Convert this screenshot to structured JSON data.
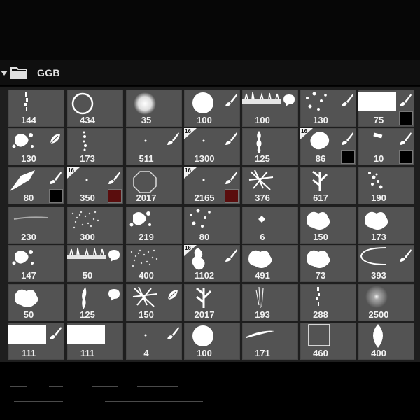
{
  "panel": {
    "group_name": "GGB"
  },
  "colors": {
    "tile": "#535353",
    "swatch_black": "#000000",
    "swatch_darkred": "#5a0d0d",
    "swatch_white": "#ffffff"
  },
  "brushes": [
    {
      "label": "144",
      "icon": "vertical-speckle-icon",
      "tool": false,
      "tag": false,
      "swatch": null
    },
    {
      "label": "434",
      "icon": "ring-icon",
      "tool": false,
      "tag": false,
      "swatch": null
    },
    {
      "label": "35",
      "icon": "soft-round-icon",
      "tool": false,
      "tag": false,
      "swatch": null
    },
    {
      "label": "100",
      "icon": "hard-round-icon",
      "tool": true,
      "tag": false,
      "swatch": null
    },
    {
      "label": "100",
      "icon": "grass-strip-icon",
      "tool": "dialog",
      "tag": false,
      "swatch": null
    },
    {
      "label": "130",
      "icon": "scatter-dots-icon",
      "tool": true,
      "tag": false,
      "swatch": null
    },
    {
      "label": "75",
      "icon": "white-rect-icon",
      "tool": true,
      "tag": false,
      "swatch": "black"
    },
    {
      "label": "130",
      "icon": "splatter-icon",
      "tool": "leaf",
      "tag": false,
      "swatch": null
    },
    {
      "label": "173",
      "icon": "dotted-line-icon",
      "tool": false,
      "tag": false,
      "swatch": null
    },
    {
      "label": "511",
      "icon": "tiny-dot-icon",
      "tool": true,
      "tag": false,
      "swatch": null
    },
    {
      "label": "1300",
      "icon": "tiny-dot-icon",
      "tool": true,
      "tag": true,
      "swatch": null
    },
    {
      "label": "125",
      "icon": "vertical-blob-icon",
      "tool": false,
      "tag": false,
      "swatch": null
    },
    {
      "label": "86",
      "icon": "blob-icon",
      "tool": true,
      "tag": true,
      "swatch": "black"
    },
    {
      "label": "10",
      "icon": "small-chip-icon",
      "tool": true,
      "tag": false,
      "swatch": "black"
    },
    {
      "label": "80",
      "icon": "wedge-icon",
      "tool": true,
      "tag": false,
      "swatch": "black"
    },
    {
      "label": "350",
      "icon": "tiny-dot-icon",
      "tool": true,
      "tag": true,
      "swatch": "darkred"
    },
    {
      "label": "2017",
      "icon": "octagon-icon",
      "tool": false,
      "tag": false,
      "swatch": null
    },
    {
      "label": "2165",
      "icon": "tiny-dot-icon",
      "tool": true,
      "tag": true,
      "swatch": "darkred"
    },
    {
      "label": "376",
      "icon": "crossed-strands-icon",
      "tool": false,
      "tag": false,
      "swatch": null
    },
    {
      "label": "617",
      "icon": "leaf-sprig-icon",
      "tool": false,
      "tag": false,
      "swatch": null
    },
    {
      "label": "190",
      "icon": "speckle-cluster-icon",
      "tool": false,
      "tag": false,
      "swatch": null
    },
    {
      "label": "230",
      "icon": "faint-line-icon",
      "tool": false,
      "tag": false,
      "swatch": null
    },
    {
      "label": "300",
      "icon": "noise-icon",
      "tool": false,
      "tag": false,
      "swatch": null
    },
    {
      "label": "219",
      "icon": "splatter-icon",
      "tool": false,
      "tag": false,
      "swatch": null
    },
    {
      "label": "80",
      "icon": "scatter-dots-icon",
      "tool": false,
      "tag": false,
      "swatch": null
    },
    {
      "label": "6",
      "icon": "diamond-icon",
      "tool": false,
      "tag": false,
      "swatch": null
    },
    {
      "label": "150",
      "icon": "cloud-blob-icon",
      "tool": false,
      "tag": false,
      "swatch": null
    },
    {
      "label": "173",
      "icon": "cloud-blob-icon",
      "tool": false,
      "tag": false,
      "swatch": null
    },
    {
      "label": "147",
      "icon": "splatter-icon",
      "tool": false,
      "tag": false,
      "swatch": null
    },
    {
      "label": "50",
      "icon": "grass-strip-icon",
      "tool": "dialog",
      "tag": false,
      "swatch": null
    },
    {
      "label": "400",
      "icon": "noise-icon",
      "tool": false,
      "tag": false,
      "swatch": null
    },
    {
      "label": "1102",
      "icon": "tree-icon",
      "tool": true,
      "tag": true,
      "swatch": null
    },
    {
      "label": "491",
      "icon": "cloud-blob-icon",
      "tool": false,
      "tag": false,
      "swatch": null
    },
    {
      "label": "73",
      "icon": "cloud-blob-icon",
      "tool": false,
      "tag": false,
      "swatch": null
    },
    {
      "label": "393",
      "icon": "curve-icon",
      "tool": true,
      "tag": false,
      "swatch": null
    },
    {
      "label": "50",
      "icon": "cloud-blob-icon",
      "tool": false,
      "tag": false,
      "swatch": null
    },
    {
      "label": "125",
      "icon": "flame-icon",
      "tool": "dialog",
      "tag": false,
      "swatch": null
    },
    {
      "label": "150",
      "icon": "crossed-strands-icon",
      "tool": "leaf",
      "tag": false,
      "swatch": null
    },
    {
      "label": "2017",
      "icon": "leaf-sprig-icon",
      "tool": false,
      "tag": false,
      "swatch": null
    },
    {
      "label": "193",
      "icon": "thin-strands-icon",
      "tool": false,
      "tag": false,
      "swatch": null
    },
    {
      "label": "288",
      "icon": "vertical-speckle-icon",
      "tool": false,
      "tag": false,
      "swatch": null
    },
    {
      "label": "2500",
      "icon": "soft-glow-icon",
      "tool": false,
      "tag": false,
      "swatch": null
    },
    {
      "label": "111",
      "icon": "white-rect-icon",
      "tool": true,
      "tag": false,
      "swatch": null
    },
    {
      "label": "111",
      "icon": "white-rect-icon",
      "tool": false,
      "tag": false,
      "swatch": null
    },
    {
      "label": "4",
      "icon": "tiny-dot-icon",
      "tool": true,
      "tag": false,
      "swatch": null
    },
    {
      "label": "100",
      "icon": "hard-round-icon",
      "tool": false,
      "tag": false,
      "swatch": null
    },
    {
      "label": "171",
      "icon": "stroke-icon",
      "tool": false,
      "tag": false,
      "swatch": null
    },
    {
      "label": "460",
      "icon": "square-outline-icon",
      "tool": false,
      "tag": false,
      "swatch": null
    },
    {
      "label": "400",
      "icon": "leaf-shape-icon",
      "tool": false,
      "tag": false,
      "swatch": null
    }
  ]
}
